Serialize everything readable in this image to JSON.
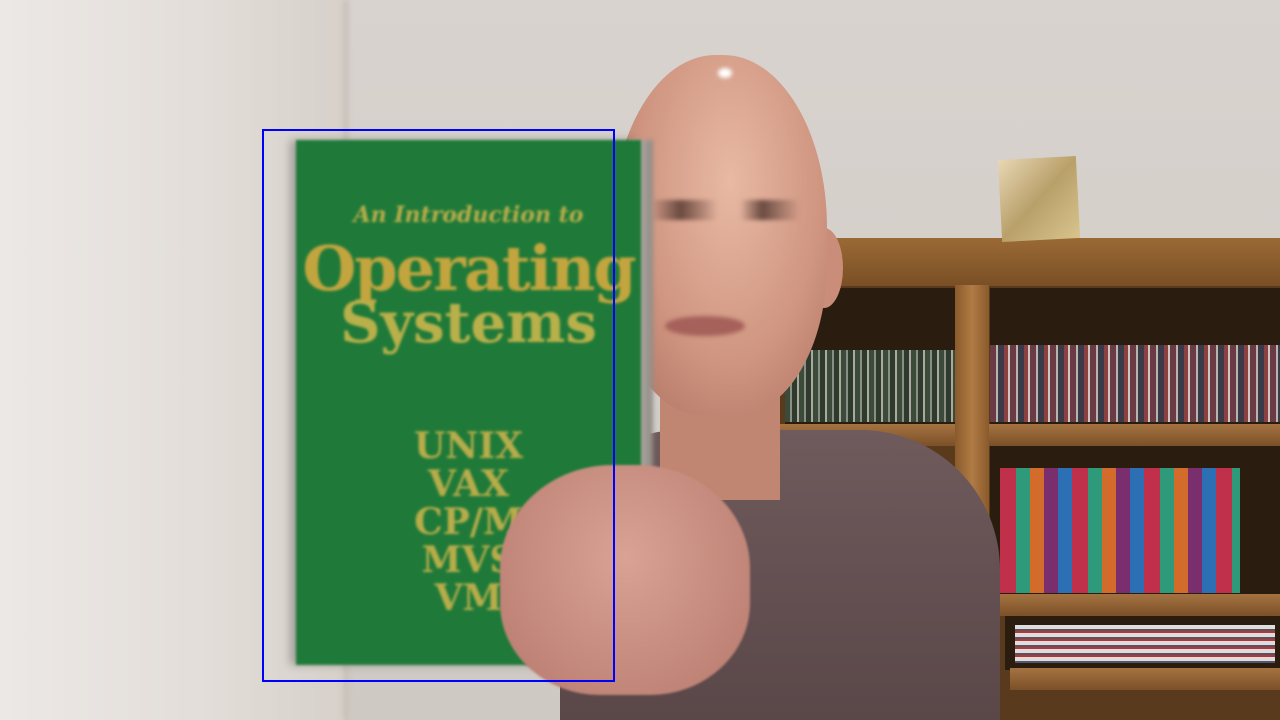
{
  "scene": {
    "book": {
      "subtitle": "An Introduction to",
      "title_line1": "Operating",
      "title_line2": "Systems",
      "systems": [
        "UNIX",
        "VAX",
        "CP/M",
        "MVS",
        "VM"
      ],
      "color": "#1f7a39"
    },
    "bounding_box_color": "#0000ff"
  }
}
